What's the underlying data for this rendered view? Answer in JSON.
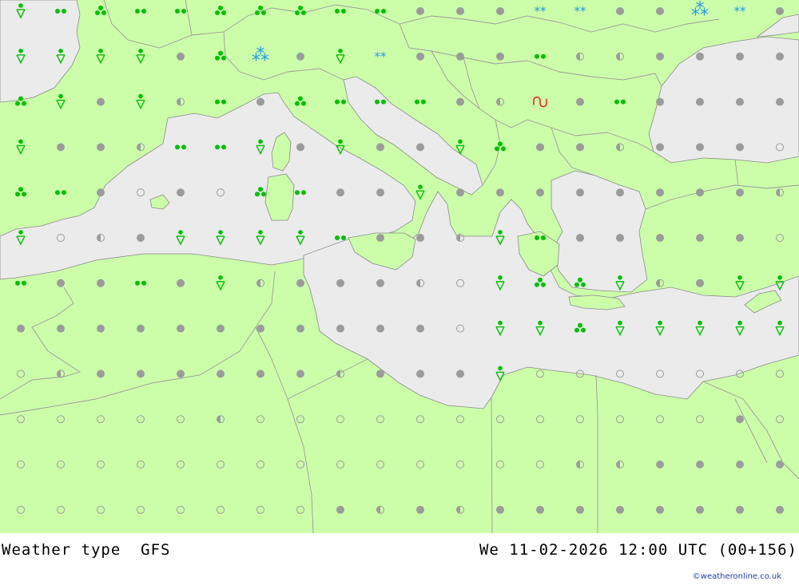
{
  "map": {
    "title": "Weather type",
    "model": "GFS",
    "valid_time": "We 11-02-2026 12:00 UTC (00+156)",
    "credit": "©weatheronline.co.uk",
    "colors": {
      "land": "#ccfeaa",
      "sea": "#ebebeb",
      "border": "#9a9a9a",
      "cloud_symbol": "#9b9b9b",
      "rain_symbol": "#00c000",
      "snow_symbol": "#1e9be8",
      "thunder_symbol": "#e02020"
    },
    "symbol_types": [
      "clear",
      "partly-cloudy",
      "cloudy",
      "drizzle",
      "rain",
      "showers",
      "snow",
      "snow-showers",
      "thunder"
    ],
    "symbol_grid": [
      [
        "showers",
        "drizzle",
        "rain",
        "drizzle",
        "drizzle",
        "rain",
        "rain",
        "rain",
        "drizzle",
        "drizzle",
        "cloudy",
        "cloudy",
        "cloudy",
        "snow",
        "snow",
        "cloudy",
        "cloudy",
        "snow-showers",
        "snow",
        "cloudy"
      ],
      [
        "showers",
        "showers",
        "showers",
        "showers",
        "cloudy",
        "rain",
        "snow-showers",
        "cloudy",
        "showers",
        "snow",
        "cloudy",
        "cloudy",
        "cloudy",
        "drizzle",
        "partly-cloudy",
        "partly-cloudy",
        "cloudy",
        "cloudy",
        "cloudy",
        "cloudy"
      ],
      [
        "rain",
        "showers",
        "cloudy",
        "showers",
        "partly-cloudy",
        "drizzle",
        "cloudy",
        "rain",
        "drizzle",
        "drizzle",
        "drizzle",
        "cloudy",
        "partly-cloudy",
        "thunder",
        "cloudy",
        "drizzle",
        "cloudy",
        "cloudy",
        "cloudy",
        "cloudy"
      ],
      [
        "showers",
        "cloudy",
        "cloudy",
        "partly-cloudy",
        "drizzle",
        "drizzle",
        "showers",
        "cloudy",
        "showers",
        "cloudy",
        "cloudy",
        "showers",
        "rain",
        "cloudy",
        "cloudy",
        "partly-cloudy",
        "cloudy",
        "cloudy",
        "cloudy",
        "clear"
      ],
      [
        "rain",
        "drizzle",
        "cloudy",
        "clear",
        "cloudy",
        "clear",
        "rain",
        "drizzle",
        "cloudy",
        "cloudy",
        "showers",
        "cloudy",
        "cloudy",
        "cloudy",
        "cloudy",
        "cloudy",
        "cloudy",
        "cloudy",
        "cloudy",
        "partly-cloudy"
      ],
      [
        "showers",
        "clear",
        "partly-cloudy",
        "cloudy",
        "showers",
        "showers",
        "showers",
        "showers",
        "drizzle",
        "cloudy",
        "cloudy",
        "partly-cloudy",
        "showers",
        "drizzle",
        "cloudy",
        "cloudy",
        "cloudy",
        "cloudy",
        "cloudy",
        "clear"
      ],
      [
        "drizzle",
        "cloudy",
        "cloudy",
        "drizzle",
        "cloudy",
        "showers",
        "partly-cloudy",
        "cloudy",
        "cloudy",
        "cloudy",
        "partly-cloudy",
        "clear",
        "showers",
        "rain",
        "rain",
        "showers",
        "partly-cloudy",
        "cloudy",
        "showers",
        "showers"
      ],
      [
        "cloudy",
        "cloudy",
        "cloudy",
        "cloudy",
        "cloudy",
        "cloudy",
        "cloudy",
        "cloudy",
        "cloudy",
        "cloudy",
        "cloudy",
        "clear",
        "showers",
        "showers",
        "rain",
        "showers",
        "showers",
        "showers",
        "showers",
        "showers"
      ],
      [
        "clear",
        "partly-cloudy",
        "cloudy",
        "cloudy",
        "cloudy",
        "cloudy",
        "cloudy",
        "cloudy",
        "partly-cloudy",
        "cloudy",
        "cloudy",
        "cloudy",
        "showers",
        "clear",
        "clear",
        "clear",
        "clear",
        "clear",
        "clear",
        "clear"
      ],
      [
        "clear",
        "clear",
        "clear",
        "clear",
        "clear",
        "partly-cloudy",
        "clear",
        "clear",
        "clear",
        "clear",
        "clear",
        "clear",
        "clear",
        "clear",
        "clear",
        "clear",
        "clear",
        "clear",
        "cloudy",
        "clear"
      ],
      [
        "clear",
        "clear",
        "clear",
        "clear",
        "clear",
        "clear",
        "clear",
        "clear",
        "clear",
        "clear",
        "clear",
        "clear",
        "clear",
        "clear",
        "partly-cloudy",
        "partly-cloudy",
        "cloudy",
        "cloudy",
        "cloudy",
        "cloudy"
      ],
      [
        "clear",
        "clear",
        "clear",
        "clear",
        "clear",
        "clear",
        "clear",
        "clear",
        "cloudy",
        "partly-cloudy",
        "cloudy",
        "partly-cloudy",
        "cloudy",
        "cloudy",
        "cloudy",
        "cloudy",
        "cloudy",
        "cloudy",
        "cloudy",
        "cloudy"
      ]
    ]
  }
}
